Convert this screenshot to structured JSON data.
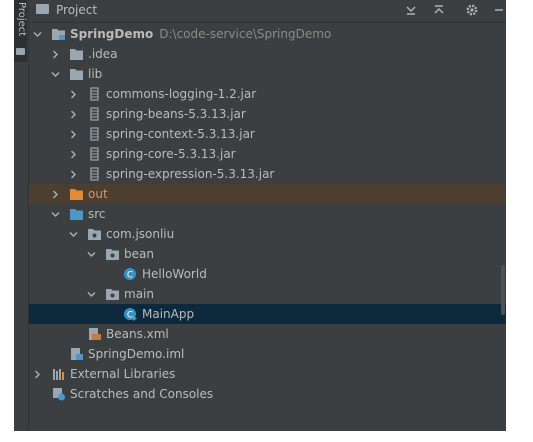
{
  "side_panel": {
    "tab_label": "Project"
  },
  "header": {
    "title": "Project"
  },
  "tree": {
    "project_name": "SpringDemo",
    "project_path": "D:\\code-service\\SpringDemo",
    "idea": ".idea",
    "lib": "lib",
    "jars": [
      "commons-logging-1.2.jar",
      "spring-beans-5.3.13.jar",
      "spring-context-5.3.13.jar",
      "spring-core-5.3.13.jar",
      "spring-expression-5.3.13.jar"
    ],
    "out": "out",
    "src": "src",
    "package": "com.jsonliu",
    "bean_pkg": "bean",
    "helloworld": "HelloWorld",
    "main_pkg": "main",
    "mainapp": "MainApp",
    "beans_xml": "Beans.xml",
    "iml": "SpringDemo.iml",
    "external_libraries": "External Libraries",
    "scratches": "Scratches and Consoles"
  },
  "colors": {
    "panel_bg": "#3c3f41",
    "text": "#bbbbbb",
    "path_text": "#8a8a8a",
    "excluded_folder_bg": "#4c3f2f",
    "excluded_folder_text": "#d19a66",
    "selection_bg": "#0d293e",
    "folder_icon": "#9aa7b0",
    "source_folder_icon": "#4f96c8",
    "class_icon": "#3592c4"
  },
  "icons": {
    "project": "module-folder-icon",
    "folder": "folder-icon",
    "jar": "jar-icon",
    "class": "java-class-icon",
    "main_class": "runnable-class-icon",
    "xml": "spring-xml-icon",
    "iml": "iml-module-file-icon",
    "libraries": "libraries-icon",
    "scratches": "scratches-icon"
  }
}
